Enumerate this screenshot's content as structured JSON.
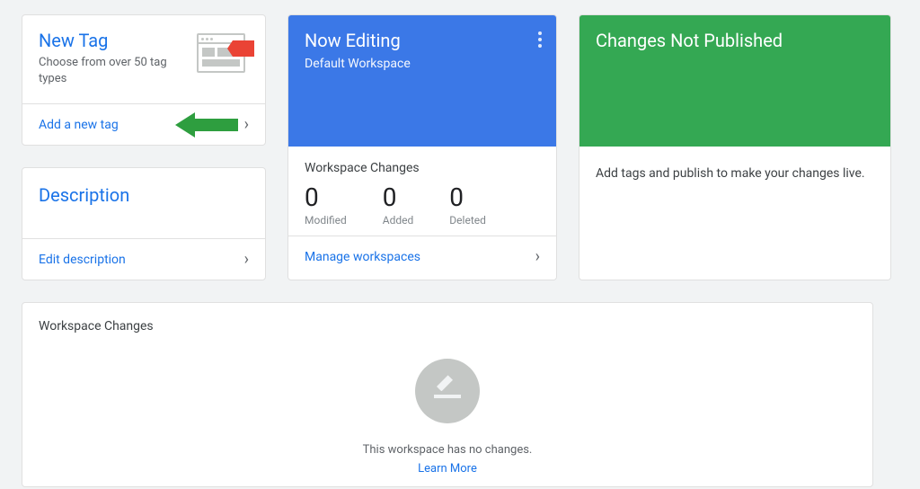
{
  "newTag": {
    "title": "New Tag",
    "subtitle": "Choose from over 50 tag types",
    "action": "Add a new tag"
  },
  "description": {
    "title": "Description",
    "action": "Edit description"
  },
  "nowEditing": {
    "title": "Now Editing",
    "workspace": "Default Workspace",
    "changesTitle": "Workspace Changes",
    "counts": {
      "modified": {
        "value": "0",
        "label": "Modified"
      },
      "added": {
        "value": "0",
        "label": "Added"
      },
      "deleted": {
        "value": "0",
        "label": "Deleted"
      }
    },
    "action": "Manage workspaces"
  },
  "changes": {
    "title": "Changes Not Published",
    "body": "Add tags and publish to make your changes live."
  },
  "workspaceChanges": {
    "title": "Workspace Changes",
    "emptyText": "This workspace has no changes.",
    "learnMore": "Learn More"
  }
}
